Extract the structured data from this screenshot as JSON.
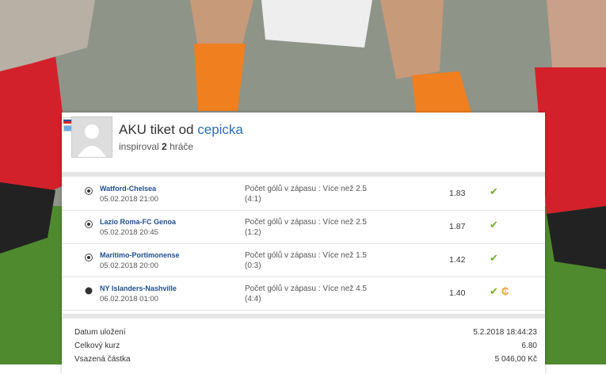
{
  "ticket": {
    "title_prefix": "AKU tiket od",
    "username": "cepicka",
    "inspired_prefix": "inspiroval",
    "inspired_count": "2",
    "inspired_suffix": "hráče"
  },
  "bets": [
    {
      "match": "Watford-Chelsea",
      "date": "05.02.2018 21:00",
      "bet": "Počet gólů v zápasu : Více než 2.5",
      "score": "(4:1)",
      "odds": "1.83",
      "status_icon": "check-icon",
      "cashout": false
    },
    {
      "match": "Lazio Roma-FC Genoa",
      "date": "05.02.2018 20:45",
      "bet": "Počet gólů v zápasu : Více než 2.5",
      "score": "(1:2)",
      "odds": "1.87",
      "status_icon": "check-icon",
      "cashout": false
    },
    {
      "match": "Maritimo-Portimonense",
      "date": "05.02.2018 20:00",
      "bet": "Počet gólů v zápasu : Více než 1.5",
      "score": "(0:3)",
      "odds": "1.42",
      "status_icon": "check-icon",
      "cashout": false
    },
    {
      "match": "NY Islanders-Nashville",
      "date": "06.02.2018 01:00",
      "bet": "Počet gólů v zápasu : Více než 4.5",
      "score": "(4:4)",
      "odds": "1.40",
      "status_icon": "check-icon",
      "cashout": true
    }
  ],
  "summary": [
    {
      "label": "Datum uložení",
      "value": "5.2.2018 18:44:23"
    },
    {
      "label": "Celkový kurz",
      "value": "6.80"
    },
    {
      "label": "Vsazená částka",
      "value": "5 046,00 Kč"
    }
  ],
  "colors": {
    "link": "#2a6ebb",
    "check": "#6fae2a",
    "coin": "#e8a425"
  }
}
